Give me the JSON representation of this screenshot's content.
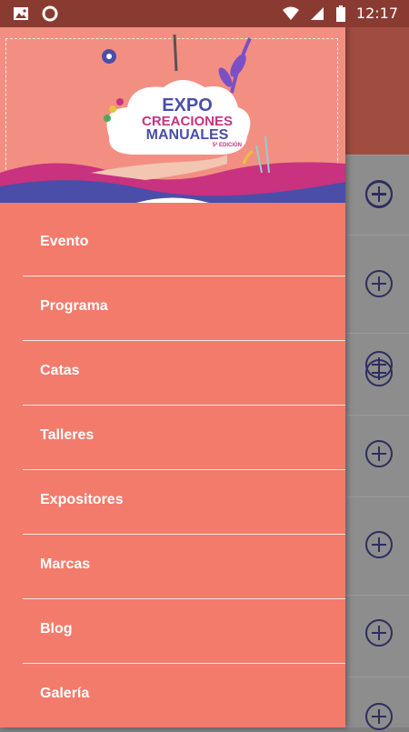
{
  "status_bar": {
    "time": "12:17",
    "left_icons": [
      "image-icon",
      "circle-icon"
    ],
    "right_icons": [
      "wifi-icon",
      "signal-icon",
      "battery-icon"
    ]
  },
  "banner": {
    "logo_line1": "EXPO",
    "logo_line2": "CREACIONES",
    "logo_line3": "MANUALES",
    "logo_edition": "5ª EDICIÓN"
  },
  "menu": {
    "items": [
      {
        "label": "Evento"
      },
      {
        "label": "Programa"
      },
      {
        "label": "Catas"
      },
      {
        "label": "Talleres"
      },
      {
        "label": "Expositores"
      },
      {
        "label": "Marcas"
      },
      {
        "label": "Blog"
      },
      {
        "label": "Galería"
      }
    ]
  },
  "colors": {
    "drawer_bg": "#f37b6b",
    "status_bar_bg": "#8a3b31",
    "divider": "#ffe6e2",
    "plus_icon": "#2d2d5e"
  }
}
